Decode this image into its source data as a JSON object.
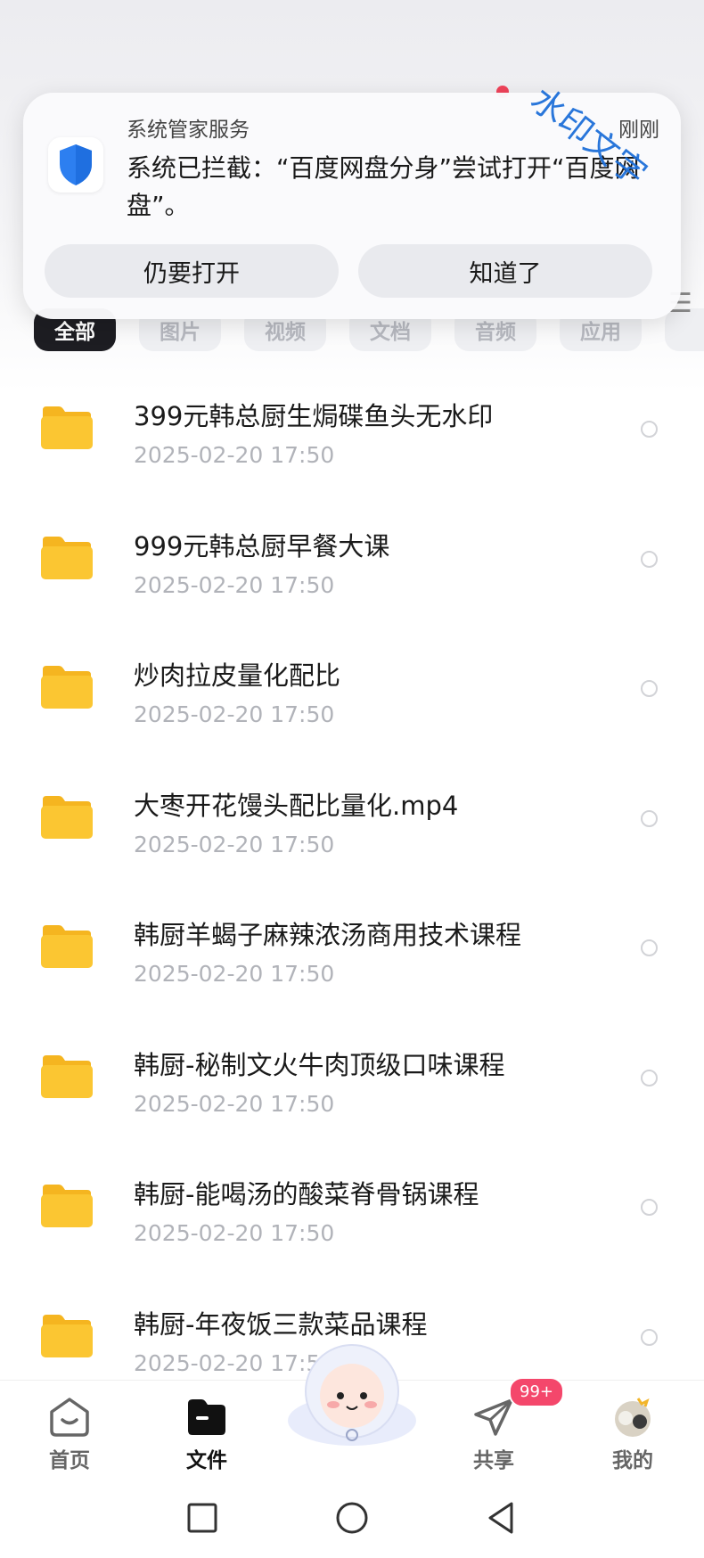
{
  "notification": {
    "app_name": "系统管家服务",
    "time": "刚刚",
    "message": "系统已拦截：“百度网盘分身”尝试打开“百度网盘”。",
    "button_open": "仍要打开",
    "button_ok": "知道了",
    "icon": "shield-icon"
  },
  "watermark": "水印文字",
  "filter_chips": [
    {
      "label": "全部",
      "active": true
    },
    {
      "label": "图片",
      "active": false
    },
    {
      "label": "视频",
      "active": false
    },
    {
      "label": "文档",
      "active": false
    },
    {
      "label": "音频",
      "active": false
    },
    {
      "label": "应用",
      "active": false
    }
  ],
  "files": [
    {
      "name": "399元韩总厨生焗碟鱼头无水印",
      "date": "2025-02-20  17:50",
      "icon": "folder-icon"
    },
    {
      "name": "999元韩总厨早餐大课",
      "date": "2025-02-20  17:50",
      "icon": "folder-icon"
    },
    {
      "name": "炒肉拉皮量化配比",
      "date": "2025-02-20  17:50",
      "icon": "folder-icon"
    },
    {
      "name": "大枣开花馒头配比量化.mp4",
      "date": "2025-02-20  17:50",
      "icon": "folder-icon"
    },
    {
      "name": "韩厨羊蝎子麻辣浓汤商用技术课程",
      "date": "2025-02-20  17:50",
      "icon": "folder-icon"
    },
    {
      "name": "韩厨-秘制文火牛肉顶级口味课程",
      "date": "2025-02-20  17:50",
      "icon": "folder-icon"
    },
    {
      "name": "韩厨-能喝汤的酸菜脊骨锅课程",
      "date": "2025-02-20  17:50",
      "icon": "folder-icon"
    },
    {
      "name": "韩厨-年夜饭三款菜品课程",
      "date": "2025-02-20  17:5",
      "icon": "folder-icon"
    }
  ],
  "tabbar": {
    "home": "首页",
    "files": "文件",
    "share": "共享",
    "share_badge": "99+",
    "me": "我的"
  },
  "colors": {
    "accent": "#1d1d22",
    "folder": "#fbc632",
    "badge": "#f4476b",
    "shield": "#2d7ff0",
    "watermark": "#1e6fd9"
  }
}
